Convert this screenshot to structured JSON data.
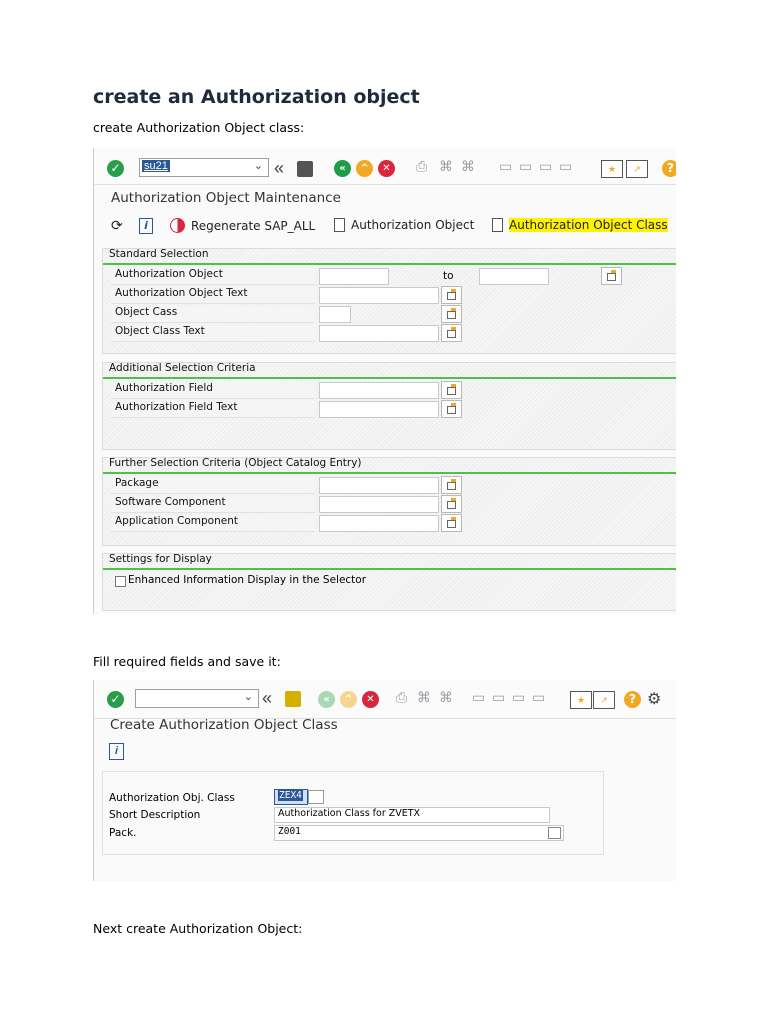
{
  "heading": "create an Authorization object",
  "para1": "create Authorization Object class:",
  "para2": "Fill required  fields and save it:",
  "para3": "Next create Authorization Object:",
  "shot1": {
    "command": "su21",
    "title": "Authorization Object Maintenance",
    "appbar": {
      "regenerate": "Regenerate SAP_ALL",
      "auth_object": "Authorization Object",
      "auth_object_class": "Authorization Object Class"
    },
    "standard": {
      "title": "Standard Selection",
      "rows": [
        "Authorization Object",
        "Authorization Object Text",
        "Object Cass",
        "Object Class Text"
      ],
      "to": "to"
    },
    "additional": {
      "title": "Additional Selection Criteria",
      "rows": [
        "Authorization Field",
        "Authorization Field Text"
      ]
    },
    "further": {
      "title": "Further Selection Criteria (Object Catalog Entry)",
      "rows": [
        "Package",
        "Software Component",
        "Application Component"
      ]
    },
    "display": {
      "title": "Settings for Display",
      "checkbox": "Enhanced Information Display in the Selector"
    }
  },
  "shot2": {
    "title": "Create Authorization Object Class",
    "fields": {
      "class_label": "Authorization Obj. Class",
      "class_value": "ZEX4",
      "desc_label": "Short Description",
      "desc_value": "Authorization Class for ZVETX",
      "pack_label": "Pack.",
      "pack_value": "Z001"
    }
  },
  "colors": {
    "section_line": "#4cc24c",
    "highlight": "#fff200",
    "ok": "#2a9d4a"
  }
}
